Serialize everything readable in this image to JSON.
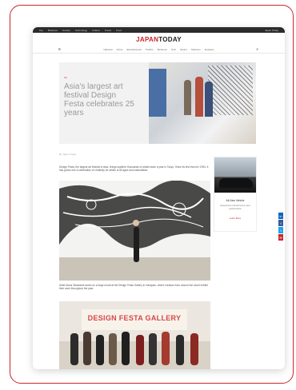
{
  "topbar": {
    "links": [
      "Top",
      "Business",
      "Society",
      "Technology",
      "Culture",
      "Travel",
      "Food"
    ],
    "right_text": "Japan Today"
  },
  "logo": {
    "part1": "JAPAN",
    "part2": "TODAY"
  },
  "nav": {
    "items": [
      "National",
      "Crime",
      "Entertainment",
      "Politics",
      "Business",
      "Tech",
      "Sports",
      "Opinions",
      "Features"
    ]
  },
  "hero": {
    "tag": "Art",
    "title": "Asia's largest art festival Design Festa celebrates 25 years"
  },
  "byline": "By Japan Today",
  "article": {
    "intro": "Design Festa, the largest art festival in Asia, brings together thousands of artists twice a year in Tokyo. Since its first event in 1994, it has grown into a celebration of creativity for artists of all ages and nationalities.",
    "caption": "Artist Mona Takahashi works on a large mural at the Design Festa Gallery in Harajuku, where creators from around the world exhibit their work throughout the year."
  },
  "ad": {
    "title": "All-New Vehicle",
    "subtitle": "Experience refined luxury and performance",
    "cta": "Learn More"
  },
  "images": {
    "art2_sign": "DESIGN FESTA GALLERY"
  },
  "colors": {
    "accent": "#c8262c",
    "dark": "#2b2b2b"
  },
  "share_icons": [
    "linkedin-icon",
    "facebook-icon",
    "twitter-icon",
    "email-icon"
  ]
}
